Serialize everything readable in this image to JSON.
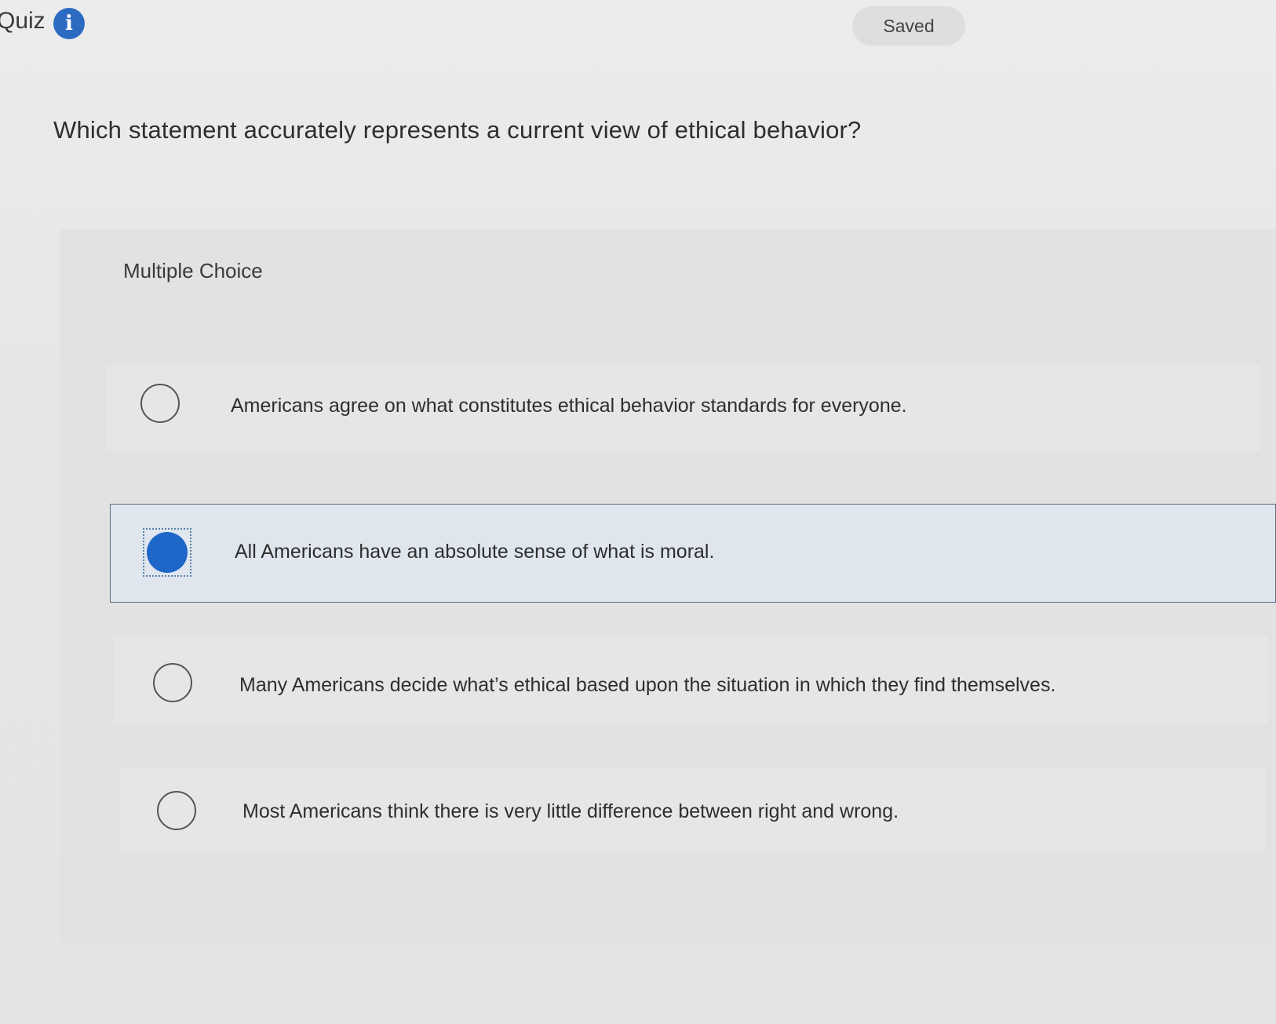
{
  "header": {
    "title": "Quiz",
    "info_icon": "info-icon",
    "status": "Saved"
  },
  "question": {
    "text": "Which statement accurately represents a current view of ethical behavior?",
    "type_label": "Multiple Choice"
  },
  "options": [
    {
      "label": "Americans agree on what constitutes ethical behavior standards for everyone.",
      "selected": false
    },
    {
      "label": "All Americans have an absolute sense of what is moral.",
      "selected": true
    },
    {
      "label": "Many Americans decide what’s ethical based upon the situation in which they find themselves.",
      "selected": false
    },
    {
      "label": "Most Americans think there is very little difference between right and wrong.",
      "selected": false
    }
  ],
  "colors": {
    "accent": "#1f66c9",
    "info_icon_bg": "#2c6bc2",
    "selected_bg": "#dfe6ee"
  }
}
